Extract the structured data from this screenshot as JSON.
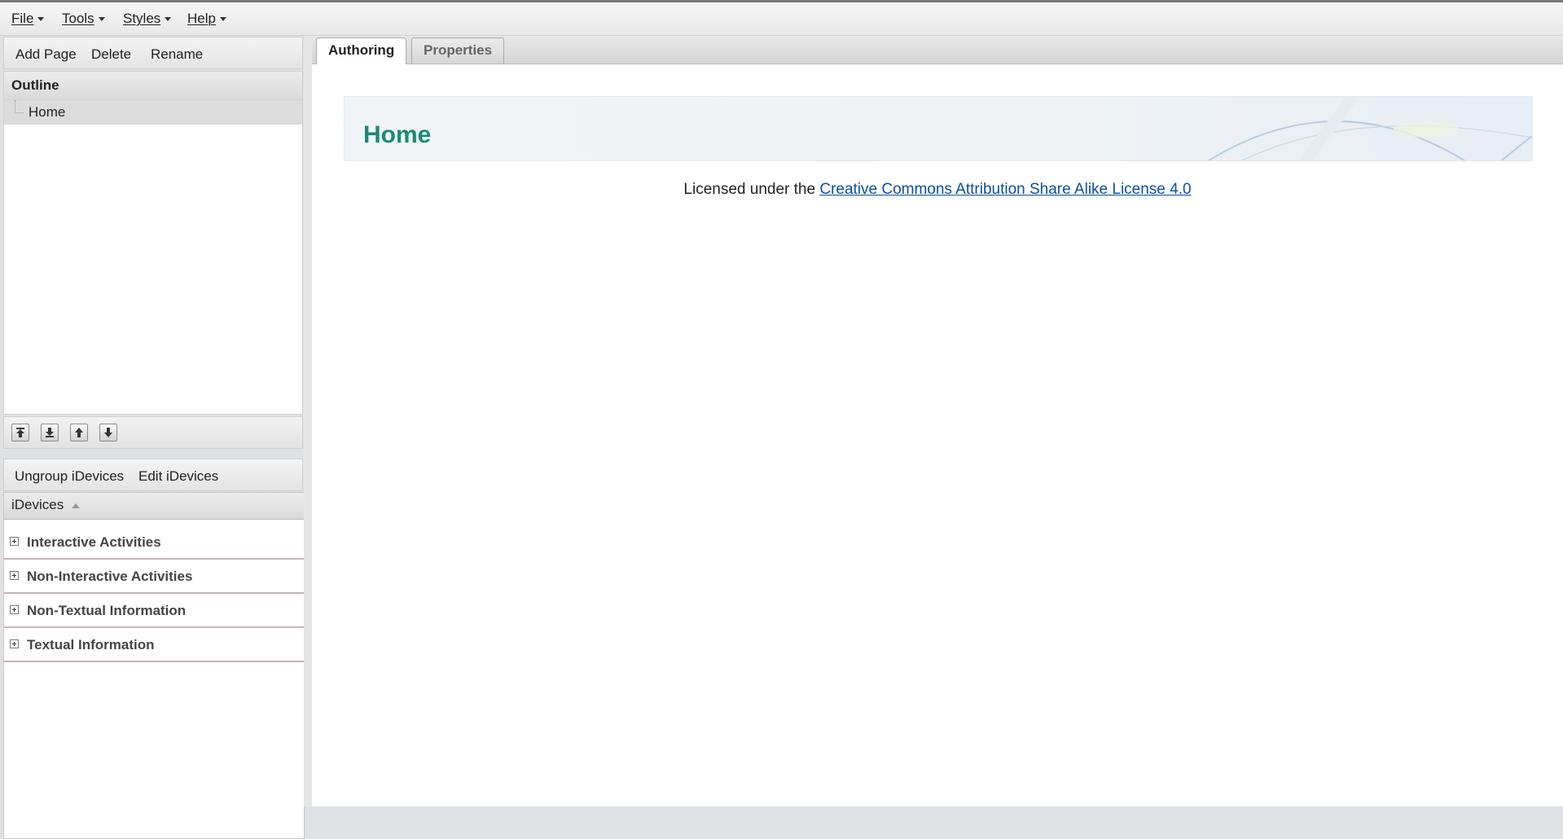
{
  "menubar": {
    "items": [
      {
        "label": "File"
      },
      {
        "label": "Tools"
      },
      {
        "label": "Styles"
      },
      {
        "label": "Help"
      }
    ]
  },
  "outline_toolbar": {
    "add_page": "Add Page",
    "delete": "Delete",
    "rename": "Rename"
  },
  "outline": {
    "header": "Outline",
    "nodes": [
      {
        "label": "Home"
      }
    ]
  },
  "move_buttons": {
    "icons": [
      "promote-icon",
      "demote-icon",
      "move-up-icon",
      "move-down-icon"
    ]
  },
  "idevices_toolbar": {
    "ungroup": "Ungroup iDevices",
    "edit": "Edit iDevices"
  },
  "idevices": {
    "header": "iDevices",
    "categories": [
      {
        "label": "Interactive Activities"
      },
      {
        "label": "Non-Interactive Activities"
      },
      {
        "label": "Non-Textual Information"
      },
      {
        "label": "Textual Information"
      }
    ]
  },
  "tabs": [
    {
      "label": "Authoring",
      "active": true
    },
    {
      "label": "Properties",
      "active": false
    }
  ],
  "page": {
    "title": "Home",
    "license_prefix": "Licensed under the ",
    "license_link": "Creative Commons Attribution Share Alike License 4.0"
  },
  "colors": {
    "title": "#1a8a76",
    "link": "#0b4f9c",
    "category_divider": "#c8b2b8"
  }
}
